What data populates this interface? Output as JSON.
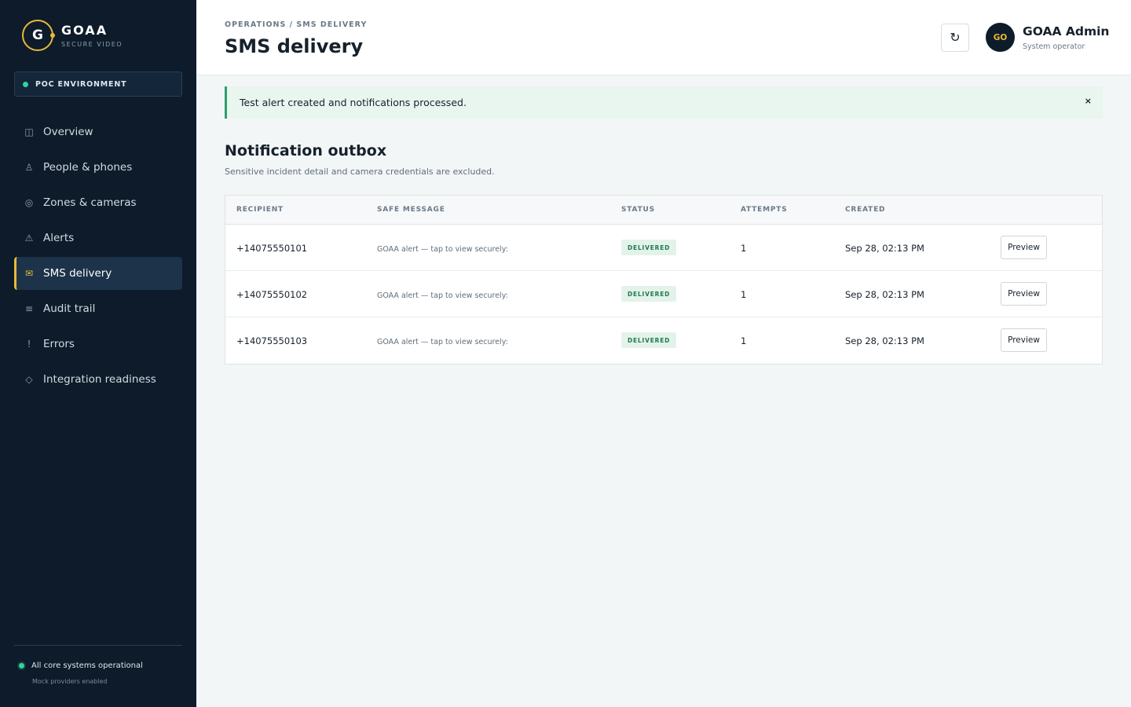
{
  "brand": {
    "initial": "G",
    "name": "GOAA",
    "subtitle": "SECURE VIDEO"
  },
  "environment": {
    "label": "POC ENVIRONMENT"
  },
  "sidebar": {
    "items": [
      {
        "label": "Overview",
        "icon": "◫",
        "icon_name": "overview-icon"
      },
      {
        "label": "People & phones",
        "icon": "♙",
        "icon_name": "person-icon"
      },
      {
        "label": "Zones & cameras",
        "icon": "◎",
        "icon_name": "camera-icon"
      },
      {
        "label": "Alerts",
        "icon": "⚠",
        "icon_name": "warning-icon"
      },
      {
        "label": "SMS delivery",
        "icon": "✉",
        "icon_name": "mail-icon",
        "active": true
      },
      {
        "label": "Audit trail",
        "icon": "≡",
        "icon_name": "list-icon"
      },
      {
        "label": "Errors",
        "icon": "!",
        "icon_name": "error-icon"
      },
      {
        "label": "Integration readiness",
        "icon": "◇",
        "icon_name": "diamond-icon"
      }
    ]
  },
  "system_status": {
    "text": "All core systems operational",
    "sub": "Mock providers enabled"
  },
  "header": {
    "breadcrumb": "OPERATIONS / SMS DELIVERY",
    "title": "SMS delivery",
    "refresh_icon": "↻",
    "user": {
      "initials": "GO",
      "name": "GOAA Admin",
      "role": "System operator"
    }
  },
  "banner": {
    "text": "Test alert created and notifications processed.",
    "close": "×"
  },
  "outbox": {
    "title": "Notification outbox",
    "subtitle": "Sensitive incident detail and camera credentials are excluded.",
    "columns": [
      "RECIPIENT",
      "SAFE MESSAGE",
      "STATUS",
      "ATTEMPTS",
      "CREATED"
    ],
    "rows": [
      {
        "recipient": "+14075550101",
        "message": "GOAA alert — tap to view securely:",
        "status": "DELIVERED",
        "attempts": "1",
        "created": "Sep 28, 02:13 PM",
        "action": "Preview"
      },
      {
        "recipient": "+14075550102",
        "message": "GOAA alert — tap to view securely:",
        "status": "DELIVERED",
        "attempts": "1",
        "created": "Sep 28, 02:13 PM",
        "action": "Preview"
      },
      {
        "recipient": "+14075550103",
        "message": "GOAA alert — tap to view securely:",
        "status": "DELIVERED",
        "attempts": "1",
        "created": "Sep 28, 02:13 PM",
        "action": "Preview"
      }
    ]
  },
  "colors": {
    "sidebar_bg": "#0d1b2a",
    "accent": "#e8b93a",
    "success": "#34d399",
    "banner_border": "#2f9d6c"
  }
}
